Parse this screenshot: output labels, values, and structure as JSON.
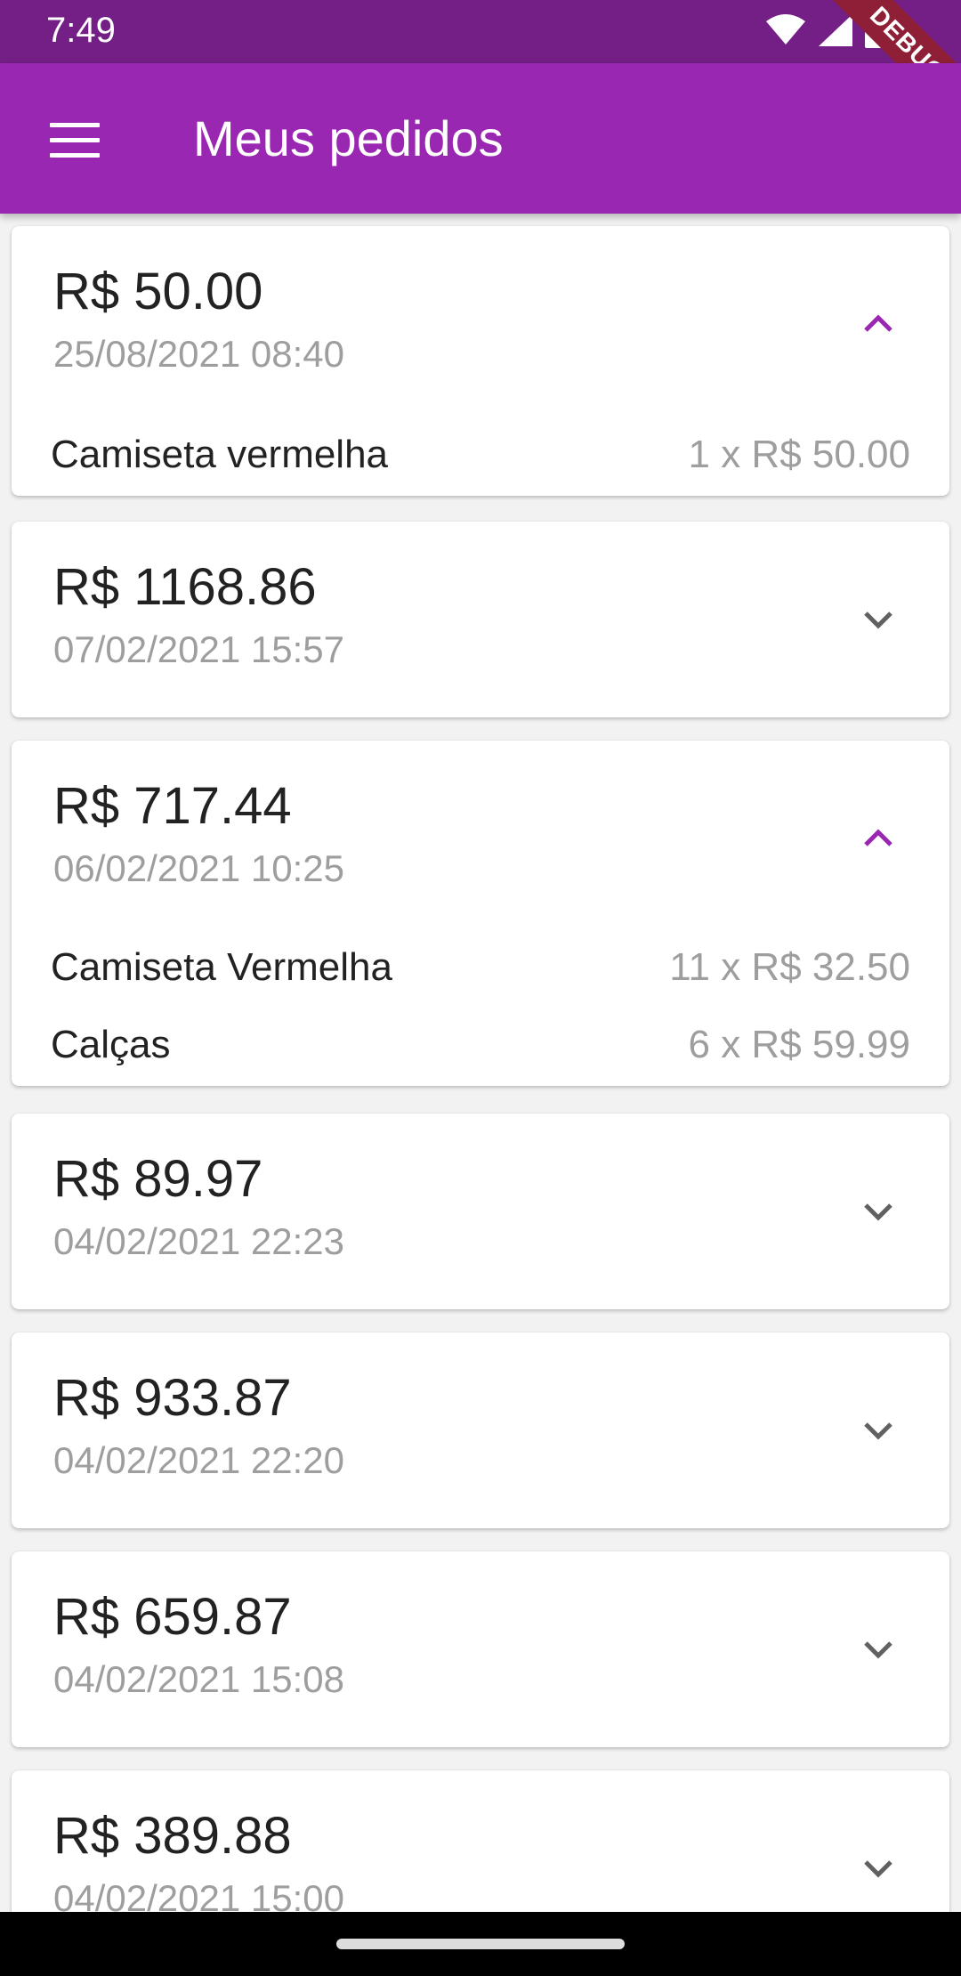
{
  "status_bar": {
    "time": "7:49",
    "debug_label": "DEBUG",
    "icons": [
      "wifi-icon",
      "signal-icon",
      "battery-icon"
    ]
  },
  "app_bar": {
    "title": "Meus pedidos",
    "menu_icon": "menu-icon",
    "color": "#9a27b1"
  },
  "orders": [
    {
      "total": "R$ 50.00",
      "date": "25/08/2021 08:40",
      "expanded": true,
      "items": [
        {
          "name": "Camiseta vermelha",
          "qty": "1 x R$ 50.00"
        }
      ]
    },
    {
      "total": "R$ 1168.86",
      "date": "07/02/2021 15:57",
      "expanded": false,
      "items": []
    },
    {
      "total": "R$ 717.44",
      "date": "06/02/2021 10:25",
      "expanded": true,
      "items": [
        {
          "name": "Camiseta Vermelha",
          "qty": "11 x R$ 32.50"
        },
        {
          "name": "Calças",
          "qty": "6 x R$ 59.99"
        }
      ]
    },
    {
      "total": "R$ 89.97",
      "date": "04/02/2021 22:23",
      "expanded": false,
      "items": []
    },
    {
      "total": "R$ 933.87",
      "date": "04/02/2021 22:20",
      "expanded": false,
      "items": []
    },
    {
      "total": "R$ 659.87",
      "date": "04/02/2021 15:08",
      "expanded": false,
      "items": []
    },
    {
      "total": "R$ 389.88",
      "date": "04/02/2021 15:00",
      "expanded": false,
      "items": []
    }
  ],
  "colors": {
    "accent": "#9a27b1",
    "status_bar": "#731f86",
    "collapsed_chevron": "#616161",
    "secondary_text": "#9e9e9e"
  }
}
